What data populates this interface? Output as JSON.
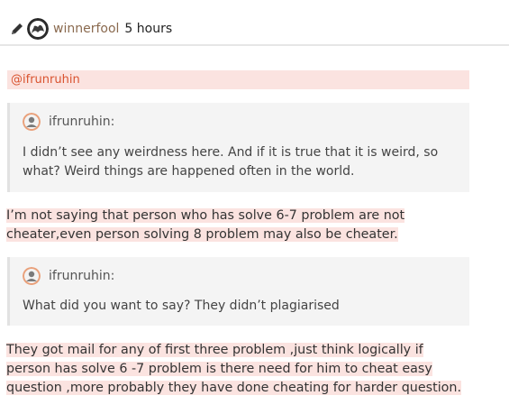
{
  "post": {
    "author": "winnerfool",
    "time": "5 hours"
  },
  "mention": "@ifrunruhin",
  "quotes": [
    {
      "author": "ifrunruhin:",
      "text": "I didn’t see any weirdness here. And if it is true that it is weird, so what? Weird things are happened often in the world."
    },
    {
      "author": "ifrunruhin:",
      "text": "What did you want to say? They didn’t plagiarised"
    }
  ],
  "paragraphs": [
    "I’m not saying that person who has solve 6-7 problem are not cheater,even person solving 8 problem may also be cheater.",
    "They got mail for any of first three problem ,just think logically if person has solve 6 -7 problem is there need for him to cheat easy question ,more probably they have done cheating for harder question."
  ],
  "icons": {
    "edit": "pencil-icon",
    "author_avatar": "avatar",
    "quote_avatar": "avatar"
  },
  "colors": {
    "highlight": "#fbe3e0",
    "mention": "#d9532f",
    "username": "#8a6a4f",
    "quote_bg": "#f4f4f4"
  }
}
